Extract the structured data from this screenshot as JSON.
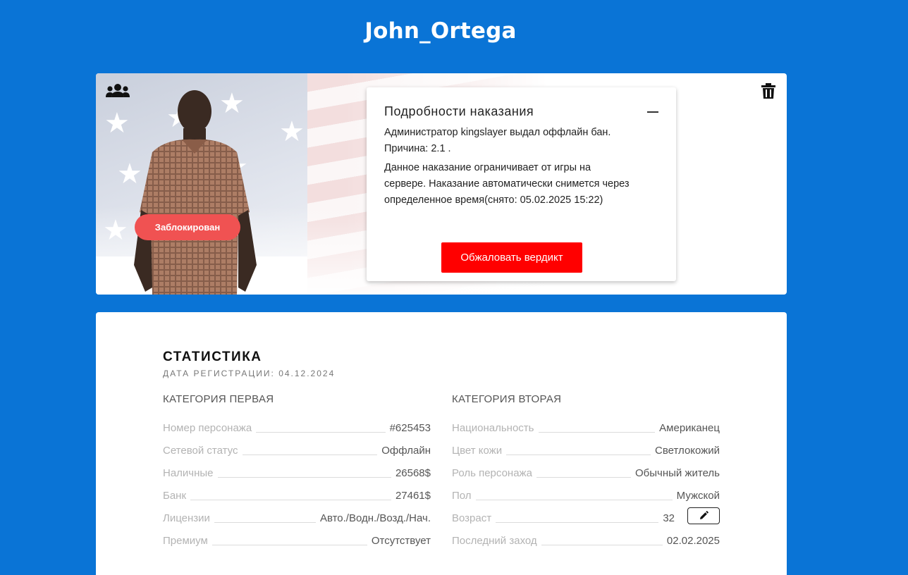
{
  "header": {
    "player_name": "John_Ortega"
  },
  "hero": {
    "badge": "Заблокирован",
    "icons": {
      "group": "users-group-icon",
      "delete": "trash-icon"
    }
  },
  "punishment": {
    "title": "Подробности наказания",
    "line1": "Администратор kingslayer выдал оффлайн бан.",
    "line2": "Причина: 2.1 .",
    "line3": "Данное наказание ограничивает от игры на",
    "line4": "сервере. Наказание автоматически снимется через",
    "line5": "определенное время(снято: 05.02.2025 15:22)",
    "appeal_label": "Обжаловать вердикт",
    "accent": "#ff0000"
  },
  "stats": {
    "title": "СТАТИСТИКА",
    "reg_date": "ДАТА РЕГИСТРАЦИИ: 04.12.2024",
    "category1": {
      "title": "КАТЕГОРИЯ ПЕРВАЯ",
      "rows": [
        {
          "label": "Номер персонажа",
          "value": "#625453"
        },
        {
          "label": "Сетевой статус",
          "value": "Оффлайн"
        },
        {
          "label": "Наличные",
          "value": "26568$"
        },
        {
          "label": "Банк",
          "value": "27461$"
        },
        {
          "label": "Лицензии",
          "value": "Авто./Водн./Возд./Нач."
        },
        {
          "label": "Премиум",
          "value": "Отсутствует"
        }
      ]
    },
    "category2": {
      "title": "КАТЕГОРИЯ ВТОРАЯ",
      "rows": [
        {
          "label": "Национальность",
          "value": "Американец"
        },
        {
          "label": "Цвет кожи",
          "value": "Светлокожий"
        },
        {
          "label": "Роль персонажа",
          "value": "Обычный житель"
        },
        {
          "label": "Пол",
          "value": "Мужской"
        },
        {
          "label": "Возраст",
          "value": "32"
        },
        {
          "label": "Последний заход",
          "value": "02.02.2025"
        }
      ]
    },
    "edit_icon": "pencil-icon"
  },
  "colors": {
    "background": "#0a74d6",
    "badge": "#f05252"
  }
}
